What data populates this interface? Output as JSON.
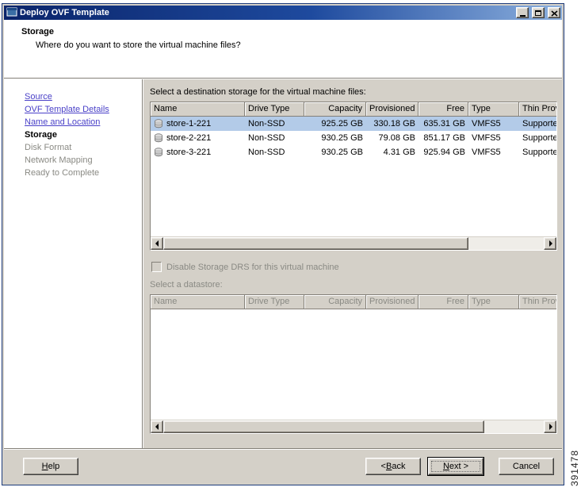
{
  "window": {
    "title": "Deploy OVF Template"
  },
  "header": {
    "title": "Storage",
    "subtitle": "Where do you want to store the virtual machine files?"
  },
  "sidebar": {
    "items": [
      {
        "label": "Source",
        "state": "completed-link"
      },
      {
        "label": "OVF Template Details",
        "state": "completed-link"
      },
      {
        "label": "Name and Location",
        "state": "completed-link"
      },
      {
        "label": "Storage",
        "state": "current"
      },
      {
        "label": "Disk Format",
        "state": "upcoming"
      },
      {
        "label": "Network Mapping",
        "state": "upcoming"
      },
      {
        "label": "Ready to Complete",
        "state": "upcoming"
      }
    ]
  },
  "main": {
    "destination_label": "Select a destination storage for the virtual machine files:",
    "storage_table": {
      "columns": [
        "Name",
        "Drive Type",
        "Capacity",
        "Provisioned",
        "Free",
        "Type",
        "Thin Prov"
      ],
      "rows": [
        {
          "name": "store-1-221",
          "drive_type": "Non-SSD",
          "capacity": "925.25 GB",
          "provisioned": "330.18 GB",
          "free": "635.31 GB",
          "type": "VMFS5",
          "thin_provisioning": "Supporte",
          "selected": true
        },
        {
          "name": "store-2-221",
          "drive_type": "Non-SSD",
          "capacity": "930.25 GB",
          "provisioned": "79.08 GB",
          "free": "851.17 GB",
          "type": "VMFS5",
          "thin_provisioning": "Supporte",
          "selected": false
        },
        {
          "name": "store-3-221",
          "drive_type": "Non-SSD",
          "capacity": "930.25 GB",
          "provisioned": "4.31 GB",
          "free": "925.94 GB",
          "type": "VMFS5",
          "thin_provisioning": "Supporte",
          "selected": false
        }
      ]
    },
    "drs_checkbox": {
      "label": "Disable Storage DRS for this virtual machine",
      "checked": false,
      "enabled": false
    },
    "datastore_label": "Select a datastore:",
    "datastore_table": {
      "columns": [
        "Name",
        "Drive Type",
        "Capacity",
        "Provisioned",
        "Free",
        "Type",
        "Thin Provis"
      ],
      "rows": []
    }
  },
  "footer": {
    "help": {
      "pre": "",
      "accel": "H",
      "post": "elp"
    },
    "back": {
      "pre": "< ",
      "accel": "B",
      "post": "ack"
    },
    "next": {
      "pre": "",
      "accel": "N",
      "post": "ext >"
    },
    "cancel_label": "Cancel"
  },
  "figure_number": "391478",
  "colors": {
    "titlebar_start": "#0a246a",
    "titlebar_end": "#a6caf0",
    "dialog_face": "#d4d0c8",
    "selection": "#b3cbe8",
    "link": "#4a41c8",
    "disabled_text": "#8a8a84"
  },
  "icons": {
    "datastore": "disk-cylinder",
    "app": "window-glyph",
    "minimize": "underscore-bar",
    "maximize": "square-outline",
    "close": "x-cross",
    "scroll_left": "triangle-left",
    "scroll_right": "triangle-right"
  }
}
